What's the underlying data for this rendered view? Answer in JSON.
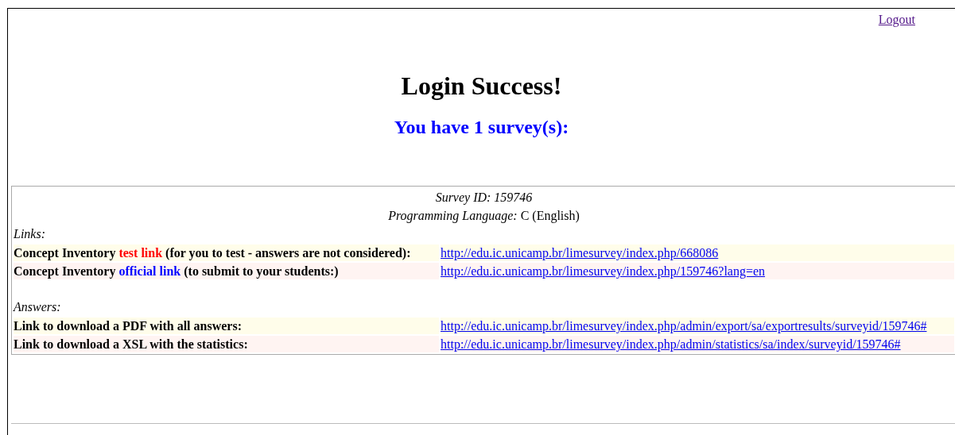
{
  "logout": "Logout",
  "title": "Login Success!",
  "subtitle": "You have 1 survey(s):",
  "survey": {
    "id_line": "Survey ID: 159746",
    "language_label": "Programming Language:",
    "language": "C (English)"
  },
  "sections": [
    {
      "heading": "Links:",
      "rows": [
        {
          "label_start": "Concept Inventory ",
          "highlight": "test link",
          "color": "#ff0000",
          "label_end": " (for you to test - answers are not considered):",
          "url": "http://edu.ic.unicamp.br/limesurvey/index.php/668086"
        },
        {
          "label_start": "Concept Inventory ",
          "highlight": "official link",
          "color": "#0000ff",
          "label_end": " (to submit to your students:)",
          "url": "http://edu.ic.unicamp.br/limesurvey/index.php/159746?lang=en"
        }
      ]
    },
    {
      "heading": "Answers:",
      "rows": [
        {
          "label_start": "Link to download a PDF with all answers:",
          "url": "http://edu.ic.unicamp.br/limesurvey/index.php/admin/export/sa/exportresults/surveyid/159746#"
        },
        {
          "label_start": "Link to download a XSL with the statistics:",
          "url": "http://edu.ic.unicamp.br/limesurvey/index.php/admin/statistics/sa/index/surveyid/159746#"
        }
      ]
    }
  ]
}
